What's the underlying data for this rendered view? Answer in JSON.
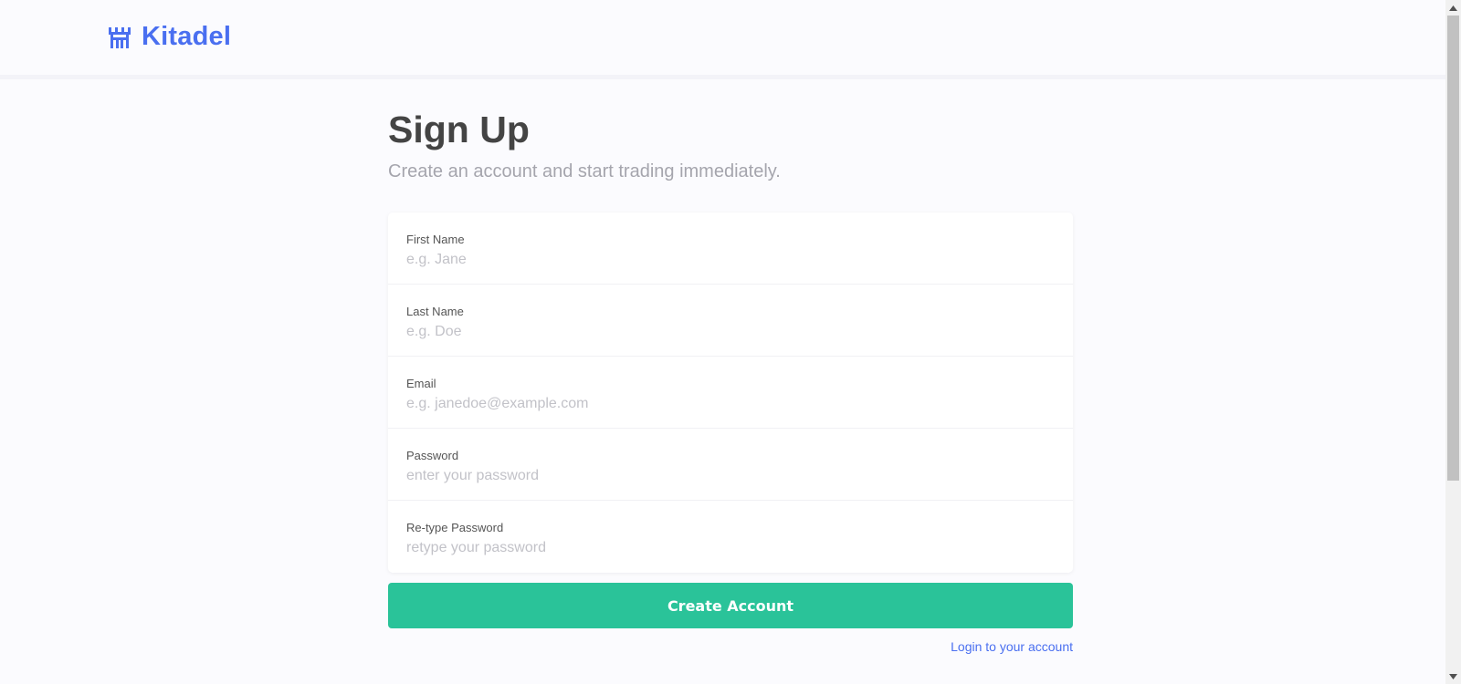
{
  "header": {
    "brand_name": "Kitadel",
    "brand_icon": "castle-icon",
    "brand_color": "#4a6ff0"
  },
  "main": {
    "title": "Sign Up",
    "subtitle": "Create an account and start trading immediately."
  },
  "form": {
    "fields": [
      {
        "label": "First Name",
        "placeholder": "e.g. Jane",
        "value": ""
      },
      {
        "label": "Last Name",
        "placeholder": "e.g. Doe",
        "value": ""
      },
      {
        "label": "Email",
        "placeholder": "e.g. janedoe@example.com",
        "value": ""
      },
      {
        "label": "Password",
        "placeholder": "enter your password",
        "value": ""
      },
      {
        "label": "Re-type Password",
        "placeholder": "retype your password",
        "value": ""
      }
    ],
    "submit_label": "Create Account",
    "submit_color": "#2ac399",
    "login_link": "Login to your account"
  }
}
